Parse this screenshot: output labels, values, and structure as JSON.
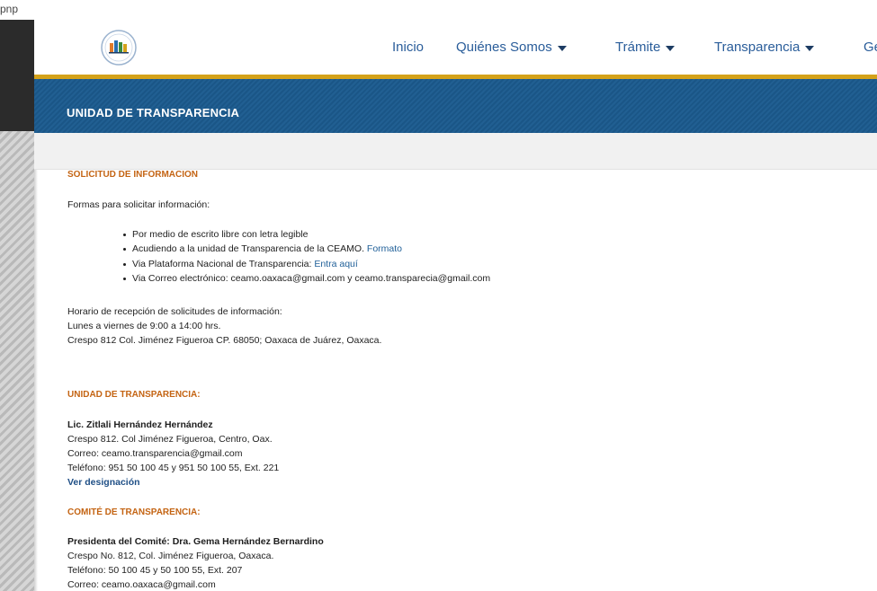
{
  "browser": {
    "url_fragment": "pnp"
  },
  "header": {
    "logo_alt": "CEAMO logo",
    "nav": [
      {
        "label": "Inicio",
        "has_dropdown": false
      },
      {
        "label": "Quiénes Somos",
        "has_dropdown": true
      },
      {
        "label": "Trámite",
        "has_dropdown": true
      },
      {
        "label": "Transparencia",
        "has_dropdown": true
      },
      {
        "label": "Ge",
        "has_dropdown": false
      }
    ]
  },
  "banner": {
    "title": "UNIDAD DE TRANSPARENCIA"
  },
  "solicitud": {
    "title": "SOLICITUD DE INFORMACION",
    "intro": "Formas para solicitar información:",
    "items": [
      {
        "text": "Por medio de escrito libre con letra legible",
        "link": ""
      },
      {
        "text": "Acudiendo a la unidad de Transparencia de la CEAMO. ",
        "link": "Formato"
      },
      {
        "text": "Via Plataforma Nacional de Transparencia: ",
        "link": "Entra aquí"
      },
      {
        "text": "Via Correo electrónico: ceamo.oaxaca@gmail.com y ceamo.transparecia@gmail.com",
        "link": ""
      }
    ],
    "hours_label": "Horario de recepción de solicitudes de información:",
    "hours": "Lunes a viernes de 9:00 a 14:00 hrs.",
    "address": "Crespo 812 Col. Jiménez Figueroa CP. 68050; Oaxaca de Juárez, Oaxaca."
  },
  "unidad": {
    "title": "UNIDAD DE TRANSPARENCIA:",
    "name": "Lic. Zitlali Hernández Hernández",
    "address": "Crespo 812. Col Jiménez Figueroa, Centro, Oax.",
    "email": "Correo: ceamo.transparencia@gmail.com",
    "phone": "Teléfono: 951 50 100 45 y 951 50 100 55, Ext. 221",
    "link": "Ver designación"
  },
  "comite": {
    "title": "COMITÉ DE TRANSPARENCIA:",
    "president": "Presidenta del Comité: Dra. Gema Hernández Bernardino",
    "address": "Crespo No. 812, Col. Jiménez Figueroa, Oaxaca.",
    "phone": "Teléfono: 50 100 45 y 50 100 55, Ext. 207",
    "email": "Correo: ceamo.oaxaca@gmail.com"
  },
  "colors": {
    "banner": "#1a5687",
    "gold": "#d4a21a",
    "section_title": "#c46413",
    "nav_text": "#2a5d9a",
    "link": "#1f5f98"
  }
}
